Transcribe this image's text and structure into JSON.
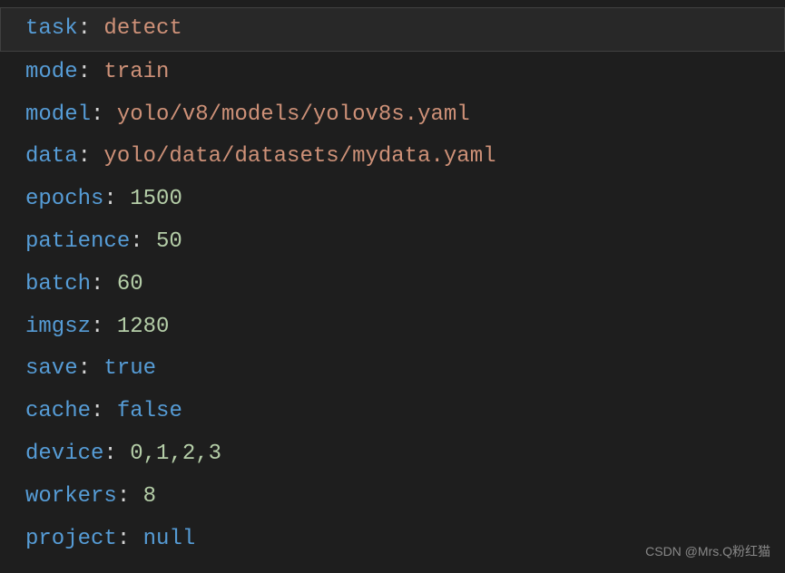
{
  "yaml": {
    "lines": [
      {
        "key": "task",
        "value": "detect",
        "type": "string",
        "highlighted": true
      },
      {
        "key": "mode",
        "value": "train",
        "type": "string",
        "highlighted": false
      },
      {
        "key": "model",
        "value": "yolo/v8/models/yolov8s.yaml",
        "type": "string",
        "highlighted": false
      },
      {
        "key": "data",
        "value": "yolo/data/datasets/mydata.yaml",
        "type": "string",
        "highlighted": false
      },
      {
        "key": "epochs",
        "value": "1500",
        "type": "number",
        "highlighted": false
      },
      {
        "key": "patience",
        "value": "50",
        "type": "number",
        "highlighted": false
      },
      {
        "key": "batch",
        "value": "60",
        "type": "number",
        "highlighted": false
      },
      {
        "key": "imgsz",
        "value": "1280",
        "type": "number",
        "highlighted": false
      },
      {
        "key": "save",
        "value": "true",
        "type": "boolean",
        "highlighted": false
      },
      {
        "key": "cache",
        "value": "false",
        "type": "boolean",
        "highlighted": false
      },
      {
        "key": "device",
        "value": "0,1,2,3",
        "type": "number",
        "highlighted": false
      },
      {
        "key": "workers",
        "value": "8",
        "type": "number",
        "highlighted": false
      },
      {
        "key": "project",
        "value": "null",
        "type": "null",
        "highlighted": false
      }
    ]
  },
  "watermark": "CSDN @Mrs.Q粉红猫"
}
